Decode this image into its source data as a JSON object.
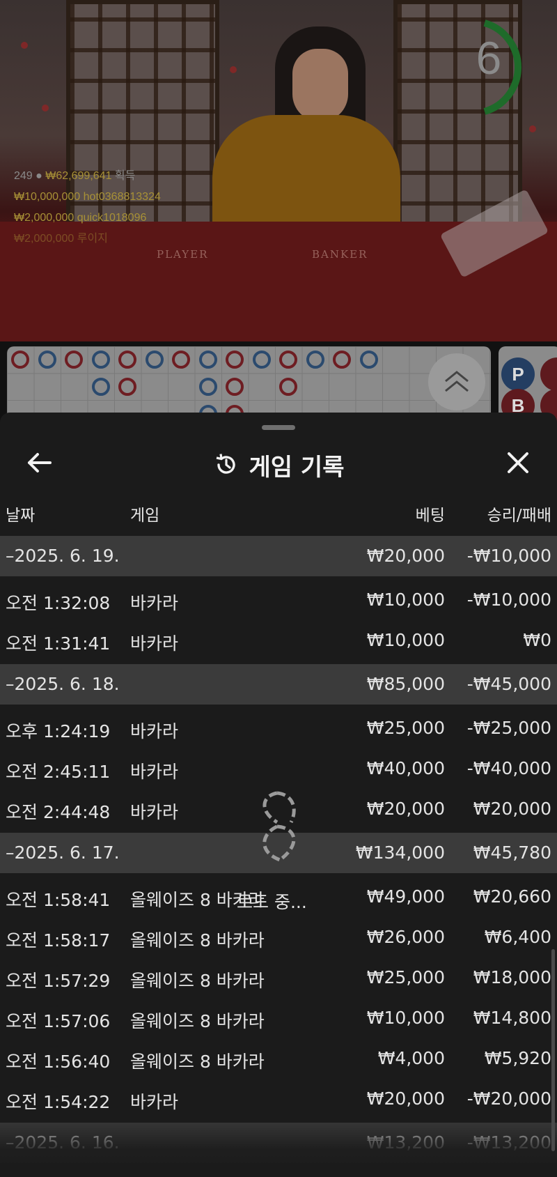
{
  "video": {
    "timer": "6",
    "felt_player": "PLAYER",
    "felt_banker": "BANKER",
    "stats": {
      "players": "249",
      "total_win": "₩62,699,641",
      "win_label": "획득",
      "winners": [
        {
          "amount": "₩10,000,000",
          "name": "hot0368813324"
        },
        {
          "amount": "₩2,000,000",
          "name": "quick1018096"
        },
        {
          "amount": "₩2,000,000",
          "name": "루이지"
        }
      ]
    },
    "side_labels": {
      "player": "P",
      "banker": "B"
    }
  },
  "sheet": {
    "title": "게임 기록",
    "columns": {
      "date": "날짜",
      "game": "게임",
      "bet": "베팅",
      "result": "승리/패배"
    },
    "rows": [
      {
        "type": "group",
        "date": "–2025. 6. 19.",
        "bet": "₩20,000",
        "result": "-₩10,000"
      },
      {
        "type": "item",
        "date": "오전 1:32:08",
        "game": "바카라",
        "bet": "₩10,000",
        "result": "-₩10,000"
      },
      {
        "type": "item",
        "date": "오전 1:31:41",
        "game": "바카라",
        "bet": "₩10,000",
        "result": "₩0"
      },
      {
        "type": "group",
        "date": "–2025. 6. 18.",
        "bet": "₩85,000",
        "result": "-₩45,000"
      },
      {
        "type": "item",
        "date": "오후 1:24:19",
        "game": "바카라",
        "bet": "₩25,000",
        "result": "-₩25,000"
      },
      {
        "type": "item",
        "date": "오전 2:45:11",
        "game": "바카라",
        "bet": "₩40,000",
        "result": "-₩40,000"
      },
      {
        "type": "item",
        "date": "오전 2:44:48",
        "game": "바카라",
        "bet": "₩20,000",
        "result": "₩20,000"
      },
      {
        "type": "group",
        "date": "–2025. 6. 17.",
        "bet": "₩134,000",
        "result": "₩45,780"
      },
      {
        "type": "item",
        "date": "오전 1:58:41",
        "game": "올웨이즈 8 바카라",
        "bet": "₩49,000",
        "result": "₩20,660"
      },
      {
        "type": "item",
        "date": "오전 1:58:17",
        "game": "올웨이즈 8 바카라",
        "bet": "₩26,000",
        "result": "₩6,400"
      },
      {
        "type": "item",
        "date": "오전 1:57:29",
        "game": "올웨이즈 8 바카라",
        "bet": "₩25,000",
        "result": "₩18,000"
      },
      {
        "type": "item",
        "date": "오전 1:57:06",
        "game": "올웨이즈 8 바카라",
        "bet": "₩10,000",
        "result": "₩14,800"
      },
      {
        "type": "item",
        "date": "오전 1:56:40",
        "game": "올웨이즈 8 바카라",
        "bet": "₩4,000",
        "result": "₩5,920"
      },
      {
        "type": "item",
        "date": "오전 1:54:22",
        "game": "바카라",
        "bet": "₩20,000",
        "result": "-₩20,000"
      },
      {
        "type": "group",
        "date": "–2025. 6. 16.",
        "bet": "₩13,200",
        "result": "-₩13,200"
      }
    ],
    "loading_text": "로드 중..."
  },
  "icons": {
    "back": "arrow-left-icon",
    "history": "history-icon",
    "close": "close-icon",
    "expand": "chevron-double-up-icon",
    "loader": "loading-spinner-icon"
  },
  "colors": {
    "sheet_bg": "#1b1b1b",
    "group_row_bg": "#3b3b3b",
    "gold_text": "#a89136",
    "player_blue": "#2b4a6e",
    "banker_red": "#6e1d22",
    "timer_green": "#1e6b2a"
  }
}
